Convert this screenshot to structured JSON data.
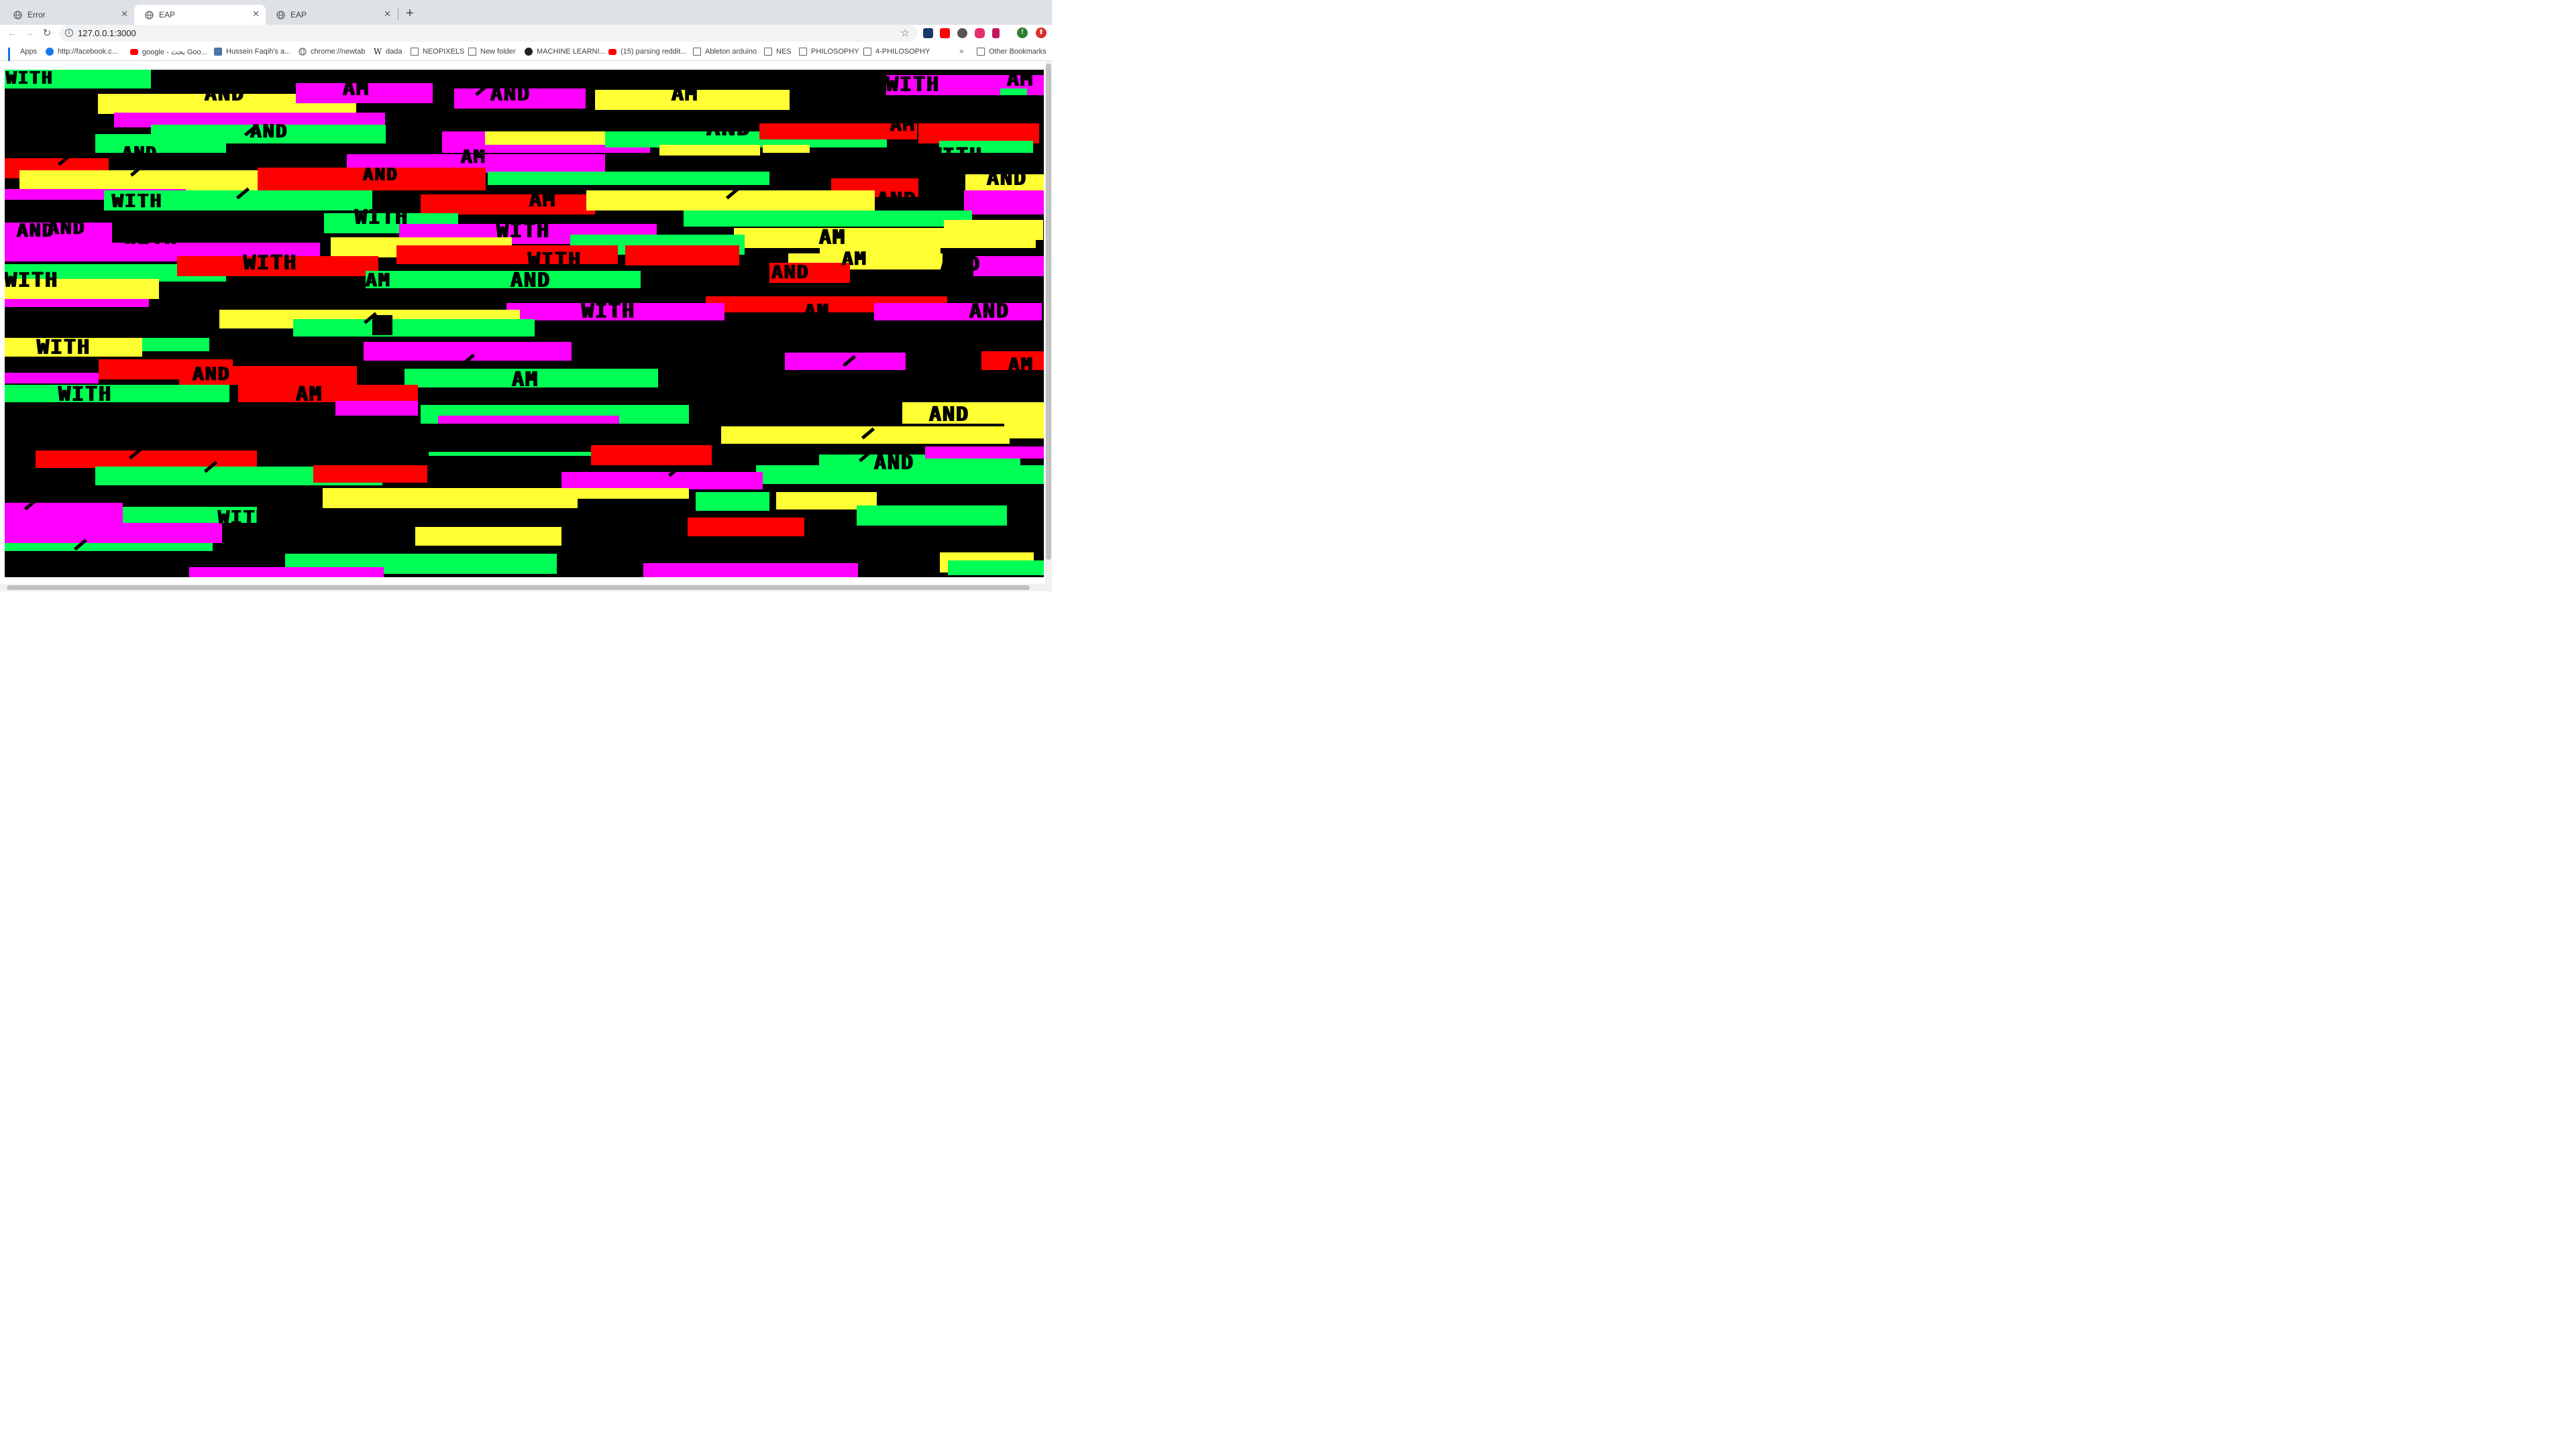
{
  "tabs": [
    {
      "title": "Error",
      "active": false,
      "icon": "globe-icon"
    },
    {
      "title": "EAP",
      "active": true,
      "icon": "globe-icon"
    },
    {
      "title": "EAP",
      "active": false,
      "icon": "globe-icon"
    }
  ],
  "toolbar": {
    "url": "127.0.0.1:3000",
    "back_icon": "arrow-left-icon",
    "forward_icon": "arrow-right-icon",
    "reload_icon": "reload-icon",
    "bookmark_star_icon": "star-icon",
    "profile_initial": "f"
  },
  "bookmarks": {
    "items": [
      {
        "label": "Apps",
        "icon": "apps-grid-icon"
      },
      {
        "label": "http://facebook.c...",
        "icon": "facebook-icon"
      },
      {
        "label": "google - بحث Goo...",
        "icon": "youtube-icon"
      },
      {
        "label": "Hussein Faqih's a...",
        "icon": "vk-icon"
      },
      {
        "label": "chrome://newtab",
        "icon": "globe-icon"
      },
      {
        "label": "dada",
        "icon": "wikipedia-icon"
      },
      {
        "label": "NEOPIXELS",
        "icon": "folder-icon"
      },
      {
        "label": "New folder",
        "icon": "folder-icon"
      },
      {
        "label": "MACHINE LEARNI...",
        "icon": "site-icon"
      },
      {
        "label": "(15) parsing reddit...",
        "icon": "youtube-icon"
      },
      {
        "label": "Ableton arduino",
        "icon": "folder-icon"
      },
      {
        "label": "NES",
        "icon": "folder-icon"
      },
      {
        "label": "PHILOSOPHY",
        "icon": "folder-icon"
      },
      {
        "label": "4-PHILOSOPHY",
        "icon": "folder-icon"
      }
    ],
    "overflow": "»",
    "other_bookmarks": "Other Bookmarks"
  },
  "page": {
    "background": "#000000",
    "palette": {
      "green": "#00ff55",
      "yellow": "#ffff33",
      "magenta": "#ff00ff",
      "red": "#ff0000"
    },
    "words": [
      "WITH",
      "AND",
      "AM",
      "AND",
      "AM",
      "WITH",
      "AM",
      "AND",
      "AND",
      "AM",
      "WITH",
      "AND",
      "AM",
      "AND",
      "WITH",
      "AND",
      "AND",
      "WITH",
      "AND",
      "AM",
      "AND",
      "WITH",
      "WITH",
      "AND",
      "WITH",
      "WITH",
      "AM",
      "WITH",
      "AND",
      "AM",
      "AND",
      "WITH",
      "AM",
      "AND",
      "AND",
      "AM",
      "WITH",
      "WITH",
      "AM",
      "AND",
      "AM",
      "WITH",
      "AM",
      "AND",
      "AND",
      "WITH",
      "WITH"
    ]
  }
}
